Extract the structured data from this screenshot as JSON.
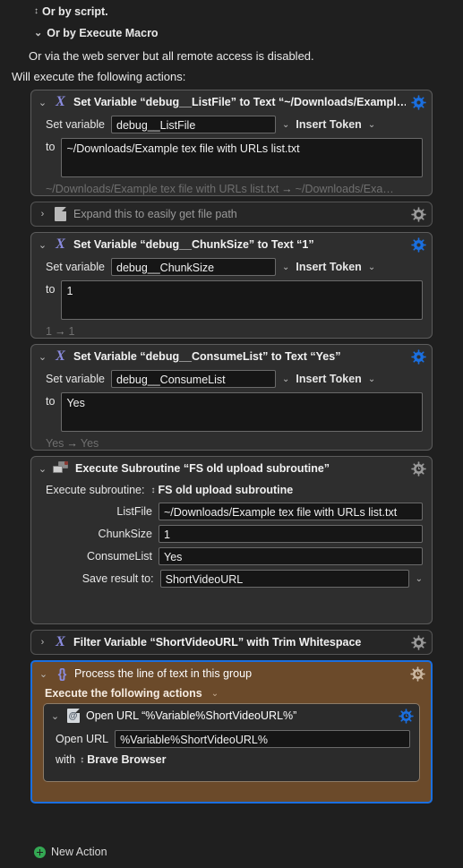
{
  "header": {
    "line_script": "Or by script.",
    "line_macro": "Or by Execute Macro",
    "line_web": "Or via the web server but all remote access is disabled.",
    "line_will_execute": "Will execute the following actions:"
  },
  "colors": {
    "window_bg": "#1f1f1f",
    "action_bg": "#2e2e2e",
    "action_border": "#5c5c5c",
    "selected_group_bg": "#6b4a2a",
    "selection_border": "#1a6fe0",
    "gear_enabled": "#1a6fe0",
    "gear_disabled": "#9a9a9a",
    "icon_purple": "#8b8ce0",
    "new_action_green": "#34a853",
    "field_bg": "#161616",
    "muted_text": "#6f6f6f"
  },
  "actions": [
    {
      "id": "set-variable-listfile",
      "title": "Set Variable “debug__ListFile” to Text “~/Downloads/Exampl…",
      "icon": "variable-x-icon",
      "gear": "gear-icon-enabled",
      "disclosure": "chevron-down-icon",
      "set_variable_label": "Set variable",
      "variable_name": "debug__ListFile",
      "insert_token_label": "Insert Token",
      "to_label": "to",
      "value": "~/Downloads/Example tex file with URLs list.txt",
      "result_before": "~/Downloads/Example tex file with URLs list.txt",
      "result_arrow": "→",
      "result_after": "~/Downloads/Exa…"
    },
    {
      "id": "expand-file-path",
      "title": "Expand this to easily get file path",
      "icon": "document-icon",
      "gear": "gear-icon-disabled",
      "disclosure": "chevron-right-icon"
    },
    {
      "id": "set-variable-chunksize",
      "title": "Set Variable “debug__ChunkSize” to Text “1”",
      "icon": "variable-x-icon",
      "gear": "gear-icon-enabled",
      "disclosure": "chevron-down-icon",
      "set_variable_label": "Set variable",
      "variable_name": "debug__ChunkSize",
      "insert_token_label": "Insert Token",
      "to_label": "to",
      "value": "1",
      "result_before": "1",
      "result_arrow": "→",
      "result_after": "1"
    },
    {
      "id": "set-variable-consumelist",
      "title": "Set Variable “debug__ConsumeList” to Text “Yes”",
      "icon": "variable-x-icon",
      "gear": "gear-icon-enabled",
      "disclosure": "chevron-down-icon",
      "set_variable_label": "Set variable",
      "variable_name": "debug__ConsumeList",
      "insert_token_label": "Insert Token",
      "to_label": "to",
      "value": "Yes",
      "result_before": "Yes",
      "result_arrow": "→",
      "result_after": "Yes"
    },
    {
      "id": "execute-subroutine",
      "title": "Execute Subroutine “FS old upload subroutine”",
      "icon": "subroutine-icon",
      "gear": "gear-icon-disabled",
      "disclosure": "chevron-down-icon",
      "execute_label": "Execute subroutine:",
      "subroutine_name": "FS old upload subroutine",
      "params": [
        {
          "label": "ListFile",
          "value": "~/Downloads/Example tex file with URLs list.txt"
        },
        {
          "label": "ChunkSize",
          "value": "1"
        },
        {
          "label": "ConsumeList",
          "value": "Yes"
        }
      ],
      "save_result_label": "Save result to:",
      "save_result_value": "ShortVideoURL"
    },
    {
      "id": "filter-variable",
      "title": "Filter Variable “ShortVideoURL” with Trim Whitespace",
      "icon": "variable-x-icon",
      "gear": "gear-icon-disabled",
      "disclosure": "chevron-right-icon"
    }
  ],
  "group": {
    "id": "process-line-group",
    "title": "Process the line of text in this group",
    "icon": "braces-icon",
    "gear": "gear-icon-disabled",
    "disclosure": "chevron-down-icon",
    "execute_following_label": "Execute the following actions",
    "selected": true,
    "child": {
      "id": "open-url",
      "title": "Open URL “%Variable%ShortVideoURL%”",
      "icon": "open-url-icon",
      "gear": "gear-icon-enabled",
      "disclosure": "chevron-down-icon",
      "open_url_label": "Open URL",
      "url_value": "%Variable%ShortVideoURL%",
      "with_label": "with",
      "browser": "Brave Browser"
    }
  },
  "footer": {
    "new_action_label": "New Action",
    "new_action_icon": "plus-circle-icon"
  },
  "glyphs": {
    "chevron_down": "⌄",
    "chevron_right": "›",
    "updown": "⇅"
  }
}
